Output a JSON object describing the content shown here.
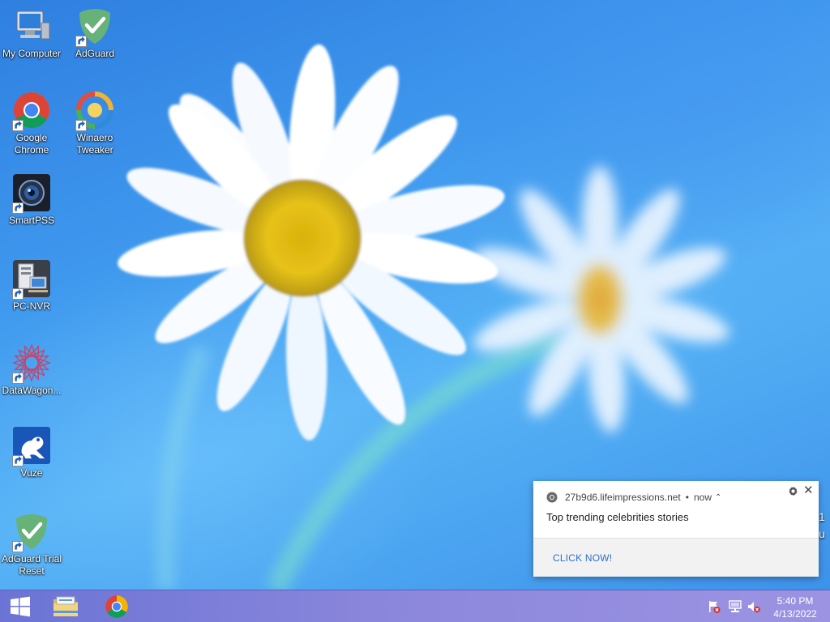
{
  "desktop": {
    "icons": [
      {
        "label": "My Computer",
        "icon": "computer-icon"
      },
      {
        "label": "AdGuard",
        "icon": "adguard-shield-icon"
      },
      {
        "label": "Google\nChrome",
        "icon": "chrome-icon"
      },
      {
        "label": "Winaero\nTweaker",
        "icon": "winaero-tweaker-icon"
      },
      {
        "label": "SmartPSS",
        "icon": "smartpss-camera-icon"
      },
      {
        "label": "PC-NVR",
        "icon": "pc-nvr-icon"
      },
      {
        "label": "DataWagon...",
        "icon": "datawagon-icon"
      },
      {
        "label": "Vuze",
        "icon": "vuze-frog-icon"
      },
      {
        "label": "AdGuard Trial\nReset",
        "icon": "adguard-shield-icon"
      }
    ],
    "clipped_text": "1\nu"
  },
  "notification": {
    "source": "27b9d6.lifeimpressions.net",
    "separator": "•",
    "time": "now",
    "expand_glyph": "⌃",
    "message": "Top trending celebrities stories",
    "action": "CLICK NOW!",
    "close_glyph": "✕",
    "icons": [
      "chrome-icon",
      "gear-icon",
      "close-icon"
    ],
    "accent": "#2f6fc9"
  },
  "taskbar": {
    "pinned": [
      "windows-start-icon",
      "file-explorer-icon",
      "chrome-icon"
    ],
    "tray": [
      "action-center-flag-icon",
      "network-icon",
      "volume-muted-icon"
    ],
    "time": "5:40 PM",
    "date": "4/13/2022",
    "color": "#8d88dc"
  }
}
